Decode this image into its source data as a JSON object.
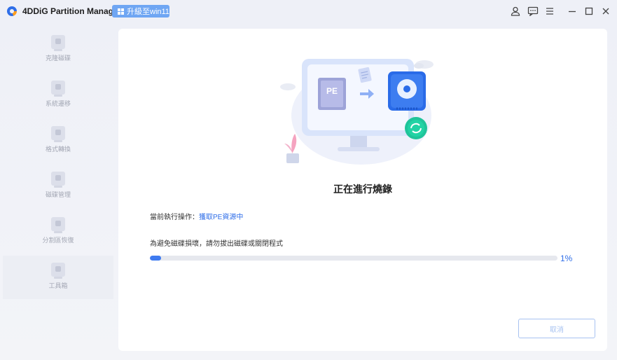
{
  "app": {
    "title": "4DDiG Partition Manager",
    "upgrade_label": "升級至win11"
  },
  "sidebar": {
    "items": [
      {
        "label": "克隆磁碟",
        "icon": "clone-disk-icon"
      },
      {
        "label": "系統遷移",
        "icon": "system-migrate-icon"
      },
      {
        "label": "格式轉換",
        "icon": "format-convert-icon"
      },
      {
        "label": "磁碟管理",
        "icon": "disk-manage-icon"
      },
      {
        "label": "分割區恢復",
        "icon": "partition-recover-icon"
      },
      {
        "label": "工具箱",
        "icon": "toolbox-icon"
      }
    ]
  },
  "main": {
    "illustration_pe_label": "PE",
    "title": "正在進行燒錄",
    "current_op_label": "當前執行操作：",
    "current_op_value": "獲取PE資源中",
    "warning": "為避免磁碟損壞，請勿拔出磁碟或關閉程式",
    "progress_text": "1%",
    "progress_fraction": 0.01,
    "cancel_label": "取消"
  },
  "colors": {
    "accent": "#3f7bf0",
    "upgrade_bg": "#6fa6f3",
    "cancel_border": "#a7c2f1",
    "teal": "#1fc49a"
  }
}
